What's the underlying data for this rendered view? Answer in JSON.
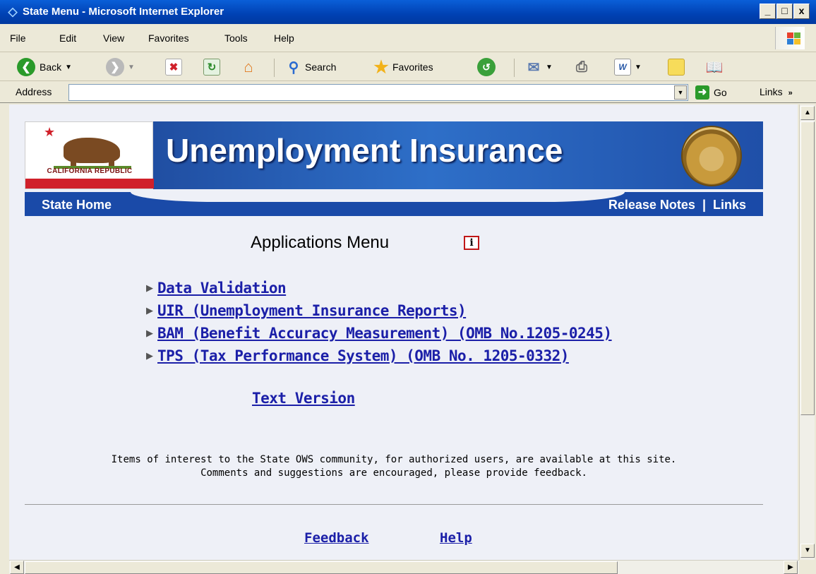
{
  "window": {
    "title": "State Menu - Microsoft Internet Explorer",
    "controls": [
      "_",
      "□",
      "x"
    ]
  },
  "menubar": {
    "items": [
      "File",
      "Edit",
      "View",
      "Favorites",
      "Tools",
      "Help"
    ]
  },
  "toolbar": {
    "back_label": "Back",
    "search_label": "Search",
    "favorites_label": "Favorites"
  },
  "addressbar": {
    "label": "Address",
    "value": "",
    "go_label": "Go",
    "links_label": "Links"
  },
  "page": {
    "flag_text": "CALIFORNIA REPUBLIC",
    "banner_title": "Unemployment Insurance",
    "nav": {
      "home": "State Home",
      "release_notes": "Release Notes",
      "separator": "|",
      "links": "Links"
    },
    "apps_title": "Applications Menu",
    "info_icon_text": "i",
    "apps": [
      {
        "label": "Data Validation"
      },
      {
        "label": "UIR (Unemployment Insurance Reports)"
      },
      {
        "label": "BAM (Benefit Accuracy Measurement) (OMB No.1205-0245)"
      },
      {
        "label": "TPS (Tax Performance System) (OMB No. 1205-0332)"
      }
    ],
    "text_version": "Text Version",
    "notice_line1": "Items of interest to the State OWS community, for authorized users, are available at this site.",
    "notice_line2": "Comments and suggestions are encouraged, please provide feedback.",
    "footer": {
      "feedback": "Feedback",
      "help": "Help"
    }
  },
  "colors": {
    "link": "#1b1fa8",
    "navbar": "#1a4aa8",
    "page_bg": "#eef0f7",
    "titlebar": "#0041b3"
  }
}
